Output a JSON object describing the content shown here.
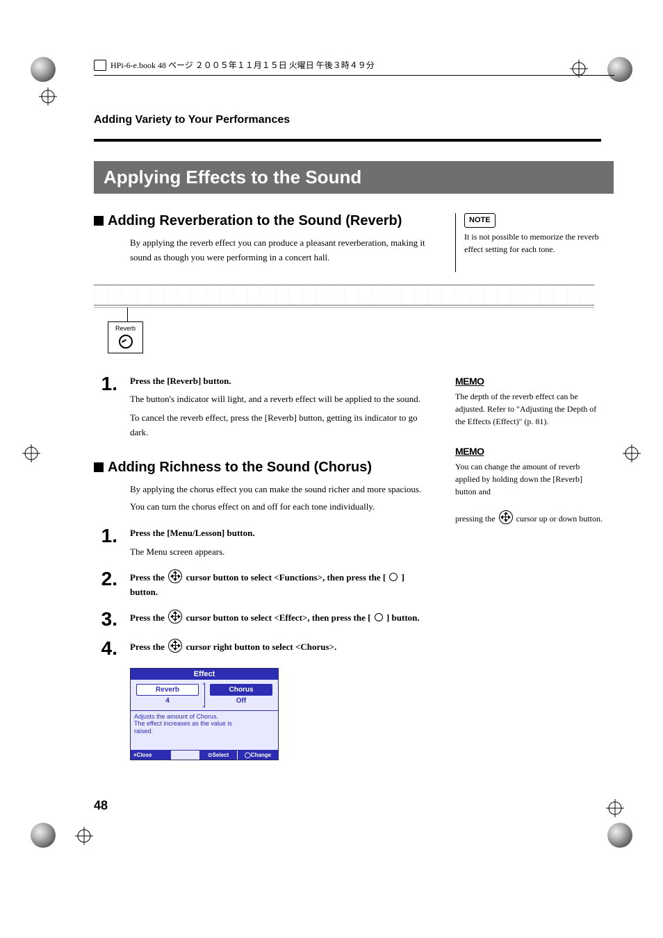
{
  "header_text": "HPi-6-e.book 48 ページ ２００５年１１月１５日 火曜日 午後３時４９分",
  "section_header": "Adding Variety to Your Performances",
  "banner_title": "Applying Effects to the Sound",
  "reverb": {
    "title": "Adding Reverberation to the Sound (Reverb)",
    "intro": "By applying the reverb effect you can produce a pleasant reverberation, making it sound as though you were performing in a concert hall.",
    "callout_label": "Reverb",
    "step1_num": "1.",
    "step1_instr": "Press the [Reverb] button.",
    "step1_p1": "The button's indicator will light, and a reverb effect will be applied to the sound.",
    "step1_p2": "To cancel the reverb effect, press the [Reverb] button, getting its indicator to go dark."
  },
  "chorus": {
    "title": "Adding Richness to the Sound (Chorus)",
    "intro_p1": "By applying the chorus effect you can make the sound richer and more spacious.",
    "intro_p2": "You can turn the chorus effect on and off for each tone individually.",
    "step1_num": "1.",
    "step1_instr": "Press the [Menu/Lesson] button.",
    "step1_p1": "The Menu screen appears.",
    "step2_num": "2.",
    "step2_a": "Press the ",
    "step2_b": " cursor button to select <Functions>, then press the [ ",
    "step2_c": " ] button.",
    "step3_num": "3.",
    "step3_a": "Press the ",
    "step3_b": " cursor button to select <Effect>, then press the [ ",
    "step3_c": " ] button.",
    "step4_num": "4.",
    "step4_a": "Press the ",
    "step4_b": " cursor right button to select <Chorus>."
  },
  "side": {
    "note_label": "NOTE",
    "note_text": "It is not possible to memorize the reverb effect setting for each tone.",
    "memo_label": "MEMO",
    "memo1_text": "The depth of the reverb effect can be adjusted. Refer to \"Adjusting the Depth of the Effects (Effect)\" (p. 81).",
    "memo2_a": "You can change the amount of reverb applied by holding down the [Reverb] button and",
    "memo2_b": "pressing the ",
    "memo2_c": " cursor up or down button."
  },
  "lcd": {
    "title": "Effect",
    "tab1_label": "Reverb",
    "tab1_value": "4",
    "tab2_label": "Chorus",
    "tab2_value": "Off",
    "desc_l1": "Adjusts the amount of Chorus.",
    "desc_l2": "The effect increases as the value is",
    "desc_l3": "raised.",
    "footer_close": "×Close",
    "footer_select": "⊙Select",
    "footer_change": "◯Change"
  },
  "page_number": "48"
}
